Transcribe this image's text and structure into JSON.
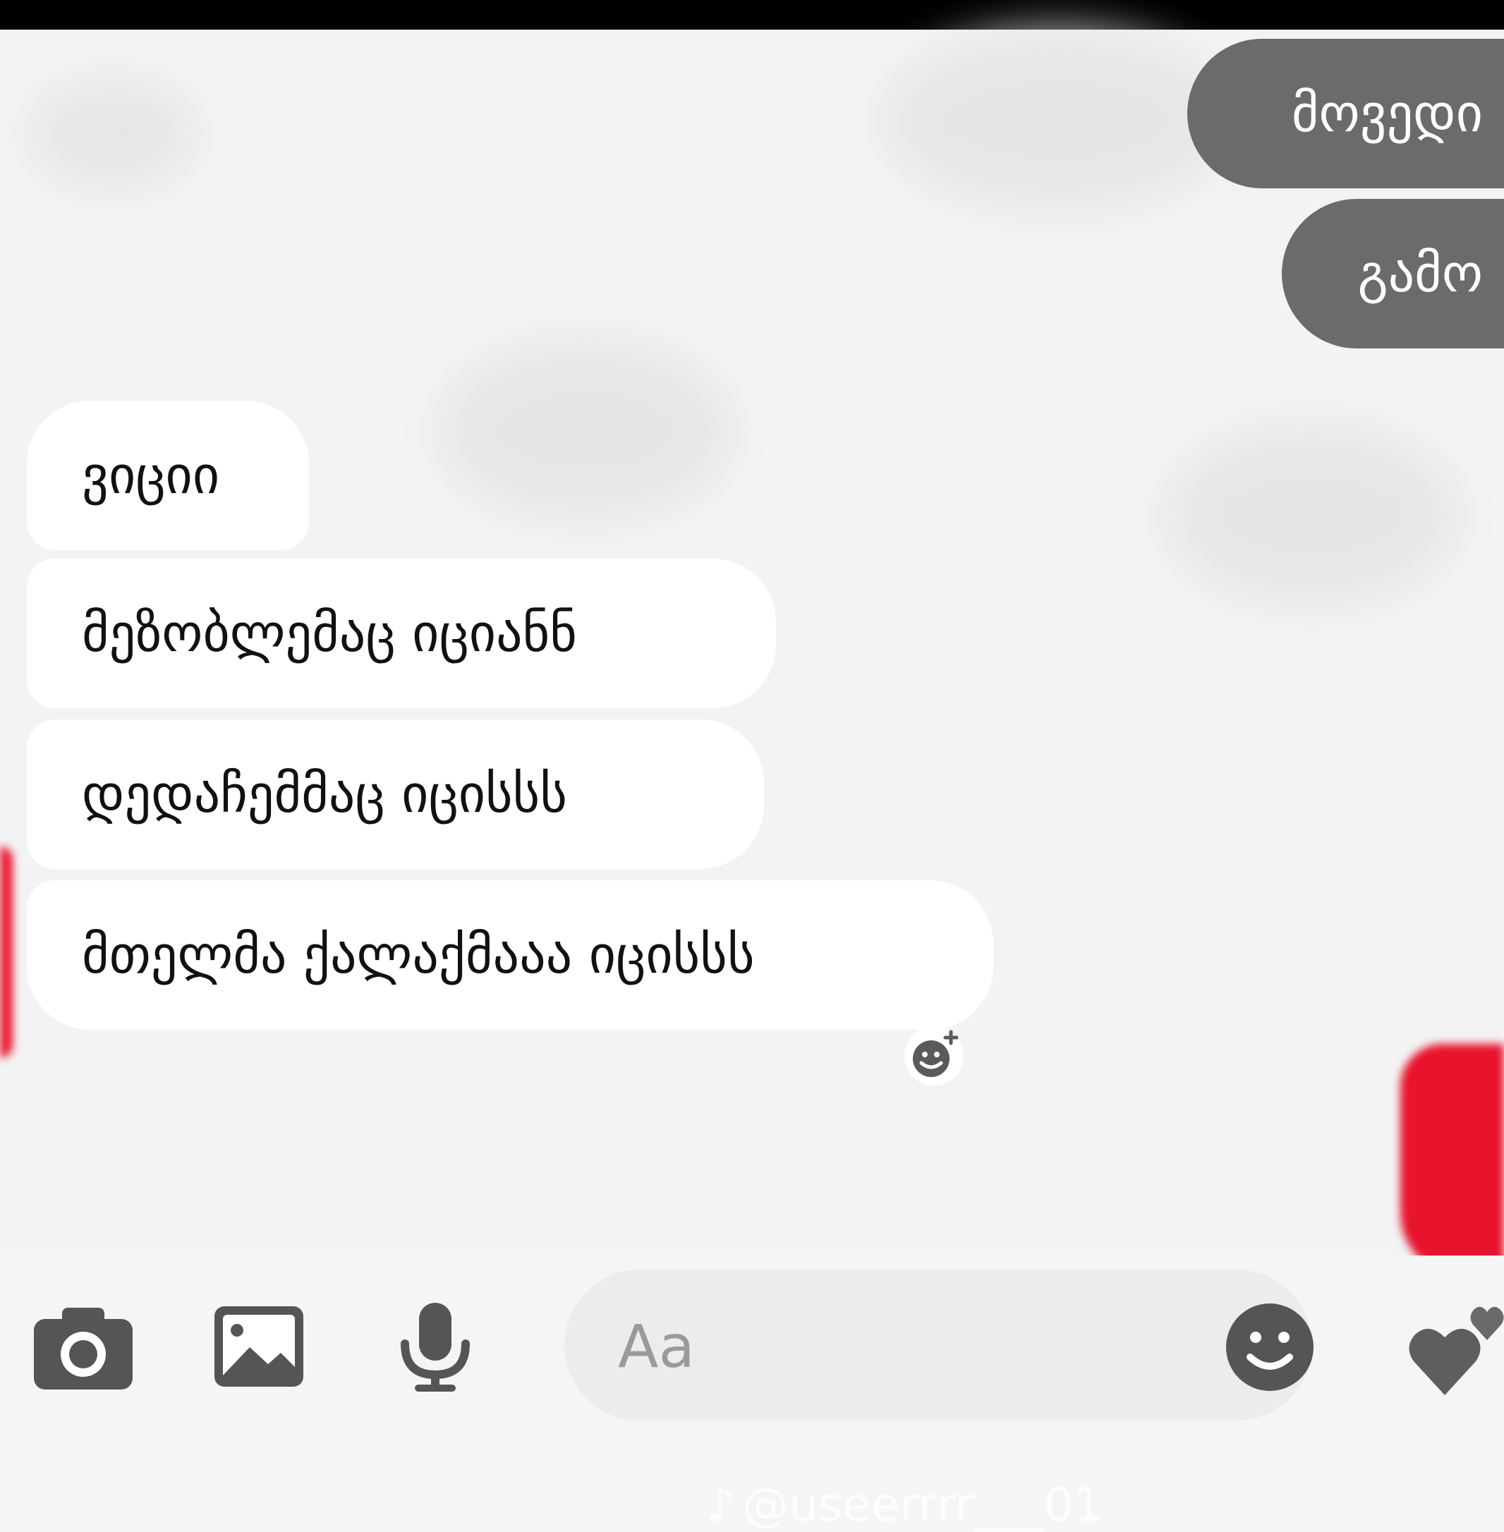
{
  "chat": {
    "sent": [
      {
        "text": "მოვედი"
      },
      {
        "text": "გამო"
      }
    ],
    "received": [
      {
        "text": "ვიციი"
      },
      {
        "text": "მეზობლემაც იციანნ"
      },
      {
        "text": "დედაჩემმაც იცისსს"
      },
      {
        "text": "მთელმა ქალაქმააა იცისსს"
      }
    ],
    "reaction_icon": "add-reaction-icon"
  },
  "composer": {
    "placeholder": "Aa",
    "icons": [
      "camera-icon",
      "image-icon",
      "microphone-icon",
      "emoji-icon",
      "heart-icon"
    ],
    "accent_color": "#555555"
  },
  "watermark": {
    "text": "@useerrrr___01"
  }
}
